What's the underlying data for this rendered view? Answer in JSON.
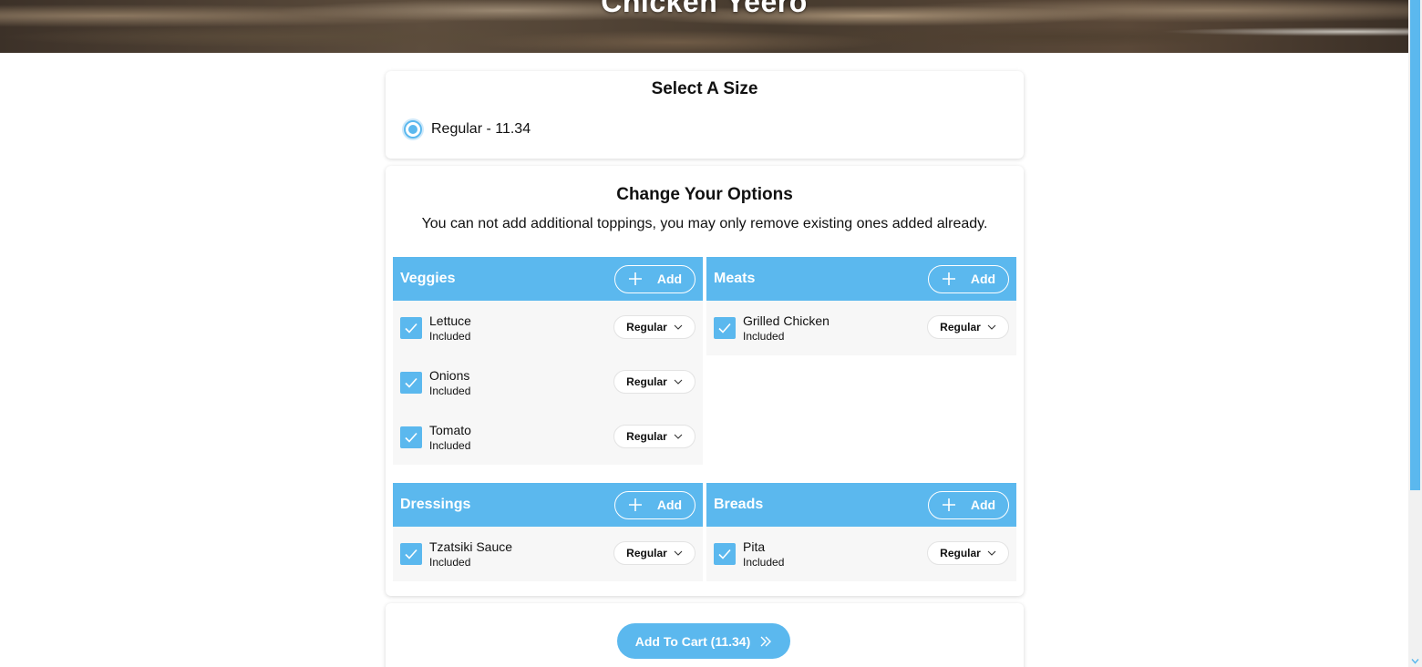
{
  "hero": {
    "title": "Chicken Yeero"
  },
  "size_section": {
    "heading": "Select A Size",
    "options": [
      {
        "label": "Regular - 11.34",
        "selected": true
      }
    ]
  },
  "options_section": {
    "heading": "Change Your Options",
    "note": "You can not add additional toppings, you may only remove existing ones added already.",
    "add_label": "Add",
    "groups": [
      {
        "title": "Veggies",
        "items": [
          {
            "name": "Lettuce",
            "status": "Included",
            "amount": "Regular",
            "checked": true
          },
          {
            "name": "Onions",
            "status": "Included",
            "amount": "Regular",
            "checked": true
          },
          {
            "name": "Tomato",
            "status": "Included",
            "amount": "Regular",
            "checked": true
          }
        ]
      },
      {
        "title": "Meats",
        "items": [
          {
            "name": "Grilled Chicken",
            "status": "Included",
            "amount": "Regular",
            "checked": true
          }
        ]
      },
      {
        "title": "Dressings",
        "items": [
          {
            "name": "Tzatsiki Sauce",
            "status": "Included",
            "amount": "Regular",
            "checked": true
          }
        ]
      },
      {
        "title": "Breads",
        "items": [
          {
            "name": "Pita",
            "status": "Included",
            "amount": "Regular",
            "checked": true
          }
        ]
      }
    ]
  },
  "cart": {
    "button_label": "Add To Cart (11.34)"
  },
  "icons": {
    "add": "plus-icon",
    "check": "checkmark-icon",
    "dropdown": "chevron-down-icon",
    "cart": "double-chevron-right-icon"
  },
  "colors": {
    "accent": "#5bb8ee",
    "text": "#111111",
    "panel": "#f7f7f7"
  }
}
